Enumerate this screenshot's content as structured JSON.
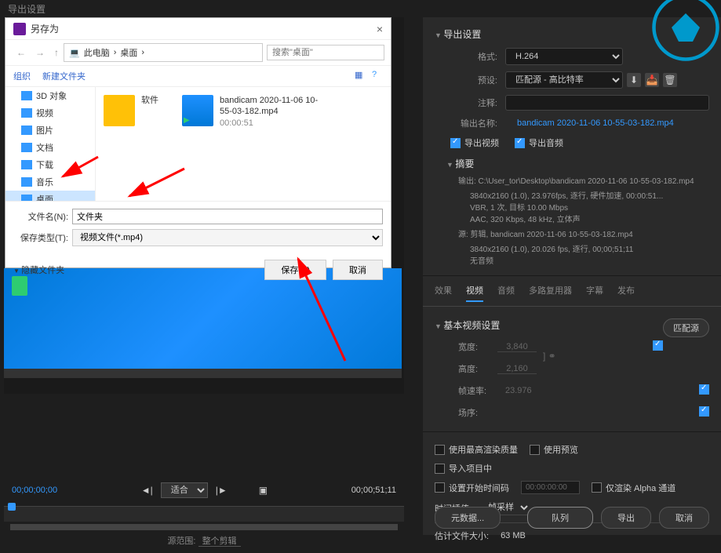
{
  "main_title": "导出设置",
  "dialog": {
    "title": "另存为",
    "breadcrumb": [
      "此电脑",
      "桌面"
    ],
    "search_placeholder": "搜索\"桌面\"",
    "toolbar": {
      "organize": "组织",
      "new_folder": "新建文件夹"
    },
    "sidebar": [
      {
        "label": "3D 对象",
        "type": "blue"
      },
      {
        "label": "视频",
        "type": "blue"
      },
      {
        "label": "图片",
        "type": "blue"
      },
      {
        "label": "文档",
        "type": "blue"
      },
      {
        "label": "下载",
        "type": "blue"
      },
      {
        "label": "音乐",
        "type": "blue"
      },
      {
        "label": "桌面",
        "type": "blue",
        "selected": true
      }
    ],
    "files": [
      {
        "name": "软件",
        "type": "folder"
      },
      {
        "name": "bandicam 2020-11-06 10-55-03-182.mp4",
        "duration": "00:00:51",
        "type": "video"
      }
    ],
    "filename_label": "文件名(N):",
    "filename_value": "文件夹",
    "filetype_label": "保存类型(T):",
    "filetype_value": "视频文件(*.mp4)",
    "hide_folders": "隐藏文件夹",
    "save_btn": "保存(S)",
    "cancel_btn": "取消"
  },
  "timeline": {
    "in_time": "00;00;00;00",
    "out_time": "00;00;51;11",
    "fit": "适合",
    "source_range_label": "源范围:",
    "source_range_value": "整个剪辑"
  },
  "export": {
    "section_title": "导出设置",
    "format_label": "格式:",
    "format_value": "H.264",
    "preset_label": "预设:",
    "preset_value": "匹配源 - 高比特率",
    "comments_label": "注释:",
    "output_label": "输出名称:",
    "output_value": "bandicam 2020-11-06 10-55-03-182.mp4",
    "export_video": "导出视频",
    "export_audio": "导出音频",
    "summary_title": "摘要",
    "summary_output": "输出: C:\\User_tor\\Desktop\\bandicam 2020-11-06 10-55-03-182.mp4",
    "summary_out_details": "3840x2160 (1.0), 23.976fps, 逐行, 硬件加速, 00:00:51...\nVBR, 1 次, 目标 10.00 Mbps\nAAC, 320 Kbps, 48 kHz, 立体声",
    "summary_source": "源: 剪辑, bandicam 2020-11-06 10-55-03-182.mp4",
    "summary_src_details": "3840x2160 (1.0), 20.026 fps, 逐行, 00;00;51;11\n无音频"
  },
  "tabs": [
    "效果",
    "视频",
    "音频",
    "多路复用器",
    "字幕",
    "发布"
  ],
  "active_tab": "视频",
  "video_settings": {
    "title": "基本视频设置",
    "match_source": "匹配源",
    "width_label": "宽度:",
    "width_value": "3,840",
    "height_label": "高度:",
    "height_value": "2,160",
    "fps_label": "帧速率:",
    "fps_value": "23.976",
    "order_label": "场序:"
  },
  "render": {
    "max_quality": "使用最高渲染质量",
    "use_preview": "使用预览",
    "import_project": "导入项目中",
    "set_start_tc": "设置开始时间码",
    "start_tc_value": "00:00:00:00",
    "alpha_only": "仅渲染 Alpha 通道",
    "interp_label": "时间插值:",
    "interp_value": "帧采样",
    "est_size_label": "估计文件大小:",
    "est_size_value": "63 MB"
  },
  "footer": {
    "metadata": "元数据...",
    "queue": "队列",
    "export": "导出",
    "cancel": "取消"
  }
}
